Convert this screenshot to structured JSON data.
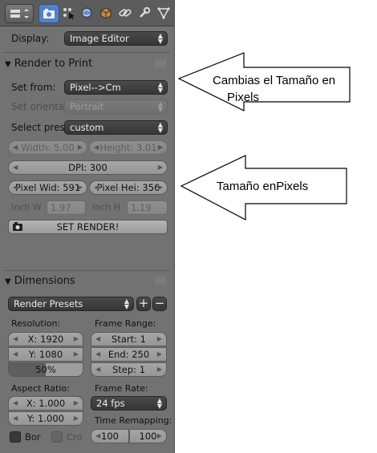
{
  "header": {
    "icons": [
      "editor-type-icon",
      "render-camera-icon",
      "layers-icon",
      "world-icon",
      "object-icon",
      "constraints-icon",
      "modifiers-wrench-icon",
      "data-icon"
    ]
  },
  "display": {
    "label": "Display:",
    "value": "Image Editor"
  },
  "render_to_print": {
    "title": "Render to Print",
    "set_from": {
      "label": "Set from:",
      "value": "Pixel-->Cm"
    },
    "set_orient": {
      "label": "Set orientat",
      "value": "Portrait"
    },
    "select_pres": {
      "label": "Select pres",
      "value": "custom"
    },
    "width": "Width: 5.00",
    "height": "Height: 3.01",
    "dpi": "DPI: 300",
    "pixel_wid": "Pixel Wid: 591",
    "pixel_hei": "Pixel Hei: 356",
    "inch_w_label": "Inch W",
    "inch_w_value": "1.97",
    "inch_h_label": "Inch H",
    "inch_h_value": "1.19",
    "set_render": "SET RENDER!"
  },
  "dimensions": {
    "title": "Dimensions",
    "presets": "Render Presets",
    "resolution_label": "Resolution:",
    "res_x": "X: 1920",
    "res_y": "Y: 1080",
    "res_pct": "50%",
    "frame_range_label": "Frame Range:",
    "start": "Start: 1",
    "end": "End: 250",
    "step": "Step: 1",
    "aspect_label": "Aspect Ratio:",
    "asp_x": "X: 1.000",
    "asp_y": "Y: 1.000",
    "frame_rate_label": "Frame Rate:",
    "fps": "24 fps",
    "time_remap_label": "Time Remapping:",
    "remap_old": "100",
    "remap_new": "100",
    "border": "Bor",
    "crop": "Cro"
  },
  "callouts": {
    "first": {
      "line1": "Cambias el Tamaño en",
      "line2": "Pixels"
    },
    "second": {
      "text": "Tamaño enPixels"
    }
  },
  "colors": {
    "panel": "#727272",
    "header": "#5c5c5c",
    "dropdown": "#3c3c3c",
    "field": "#9e9e9e",
    "accent": "#5680c2"
  }
}
